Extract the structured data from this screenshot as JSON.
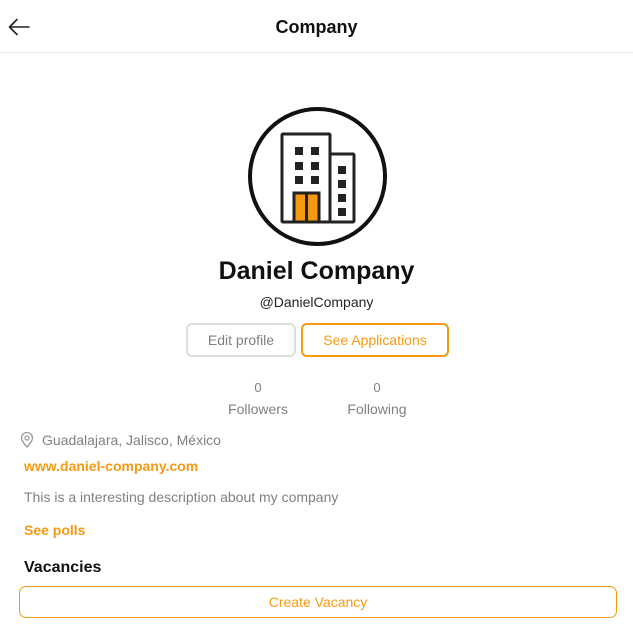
{
  "header": {
    "title": "Company",
    "back_icon": "arrow-left-icon"
  },
  "profile": {
    "avatar_icon": "building-icon",
    "name": "Daniel Company",
    "handle": "@DanielCompany",
    "edit_label": "Edit profile",
    "applications_label": "See Applications"
  },
  "stats": {
    "followers": {
      "count": "0",
      "label": "Followers"
    },
    "following": {
      "count": "0",
      "label": "Following"
    }
  },
  "details": {
    "location_icon": "map-pin-icon",
    "location": "Guadalajara, Jalisco, México",
    "website": "www.daniel-company.com",
    "description": "This is a interesting description about my company",
    "polls_label": "See polls"
  },
  "vacancies": {
    "title": "Vacancies",
    "create_label": "Create Vacancy"
  },
  "colors": {
    "accent": "#f59a12",
    "muted_text": "#808080",
    "border_gray": "#dedede",
    "text": "#111111"
  }
}
